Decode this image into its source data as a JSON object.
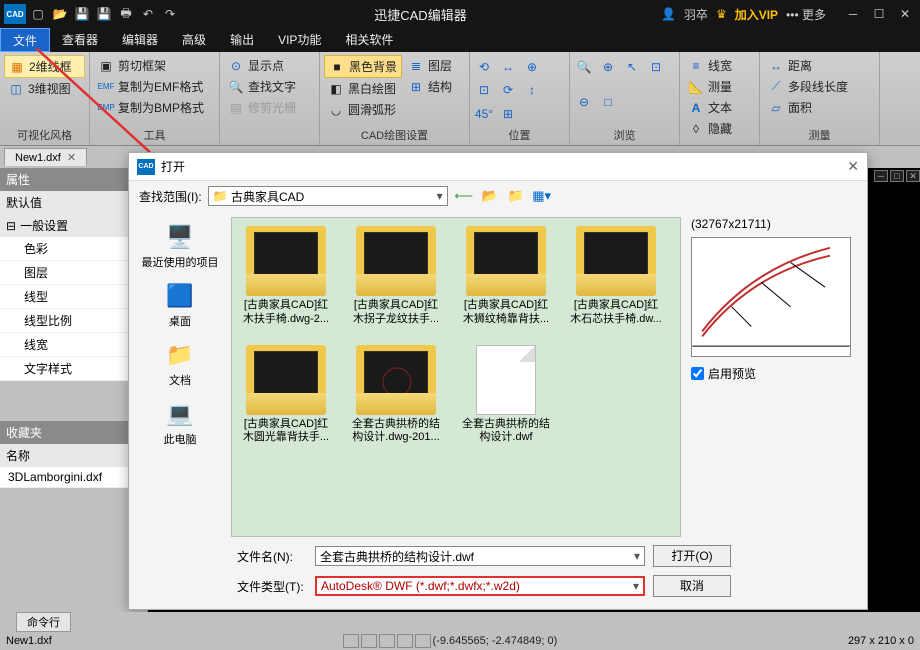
{
  "titlebar": {
    "app_icon": "CAD",
    "title": "迅捷CAD编辑器",
    "user": "羽卒",
    "vip_label": "加入VIP",
    "more_label": "更多"
  },
  "menu": {
    "items": [
      "文件",
      "查看器",
      "编辑器",
      "高级",
      "输出",
      "VIP功能",
      "相关软件"
    ]
  },
  "ribbon": {
    "groups": [
      {
        "label": "可视化风格",
        "buttons": [
          "2维线框",
          "3维视图"
        ]
      },
      {
        "label": "工具",
        "buttons": [
          "剪切框架",
          "复制为EMF格式",
          "复制为BMP格式"
        ]
      },
      {
        "label": "",
        "buttons": [
          "显示点",
          "查找文字",
          "修剪光栅"
        ]
      },
      {
        "label": "CAD绘图设置",
        "buttons": [
          "黑色背景",
          "黑白绘图",
          "圆滑弧形",
          "图层",
          "结构"
        ]
      },
      {
        "label": "位置",
        "icons": 8
      },
      {
        "label": "浏览",
        "icons": 6
      },
      {
        "label": "",
        "buttons": [
          "线宽",
          "测量",
          "文本",
          "隐藏"
        ]
      },
      {
        "label": "测量",
        "buttons": [
          "距离",
          "多段线长度",
          "面积"
        ]
      }
    ]
  },
  "doc_tab": {
    "label": "New1.dxf"
  },
  "side": {
    "prop_hdr": "属性",
    "default_hdr": "默认值",
    "general_hdr": "一般设置",
    "items": [
      "色彩",
      "图层",
      "线型",
      "线型比例",
      "线宽",
      "文字样式"
    ],
    "fav_hdr": "收藏夹",
    "name_hdr": "名称",
    "fav_item": "3DLamborgini.dxf"
  },
  "dialog": {
    "title": "打开",
    "scope_label": "查找范围(I):",
    "scope_value": "古典家具CAD",
    "places": [
      {
        "icon": "🖥️",
        "label": "最近使用的项目"
      },
      {
        "icon": "🟦",
        "label": "桌面"
      },
      {
        "icon": "📁",
        "label": "文档"
      },
      {
        "icon": "💻",
        "label": "此电脑"
      }
    ],
    "files": [
      {
        "type": "folder",
        "label": "[古典家具CAD]红木扶手椅.dwg-2..."
      },
      {
        "type": "folder",
        "label": "[古典家具CAD]红木拐子龙纹扶手..."
      },
      {
        "type": "folder",
        "label": "[古典家具CAD]红木狮纹椅靠背扶..."
      },
      {
        "type": "folder",
        "label": "[古典家具CAD]红木石芯扶手椅.dw..."
      },
      {
        "type": "folder",
        "label": "[古典家具CAD]红木圆光靠背扶手..."
      },
      {
        "type": "folder",
        "label": "全套古典拱桥的结构设计.dwg-201..."
      },
      {
        "type": "dwf",
        "label": "全套古典拱桥的结构设计.dwf"
      }
    ],
    "preview_dim": "(32767x21711)",
    "preview_chk": "启用预览",
    "filename_label": "文件名(N):",
    "filename_value": "全套古典拱桥的结构设计.dwf",
    "filetype_label": "文件类型(T):",
    "filetype_value": "AutoDesk® DWF (*.dwf;*.dwfx;*.w2d)",
    "open_btn": "打开(O)",
    "cancel_btn": "取消"
  },
  "cmdline": {
    "label": "命令行"
  },
  "status": {
    "file": "New1.dxf",
    "coords": "(-9.645565; -2.474849; 0)",
    "zoom": "297 x 210 x 0"
  }
}
